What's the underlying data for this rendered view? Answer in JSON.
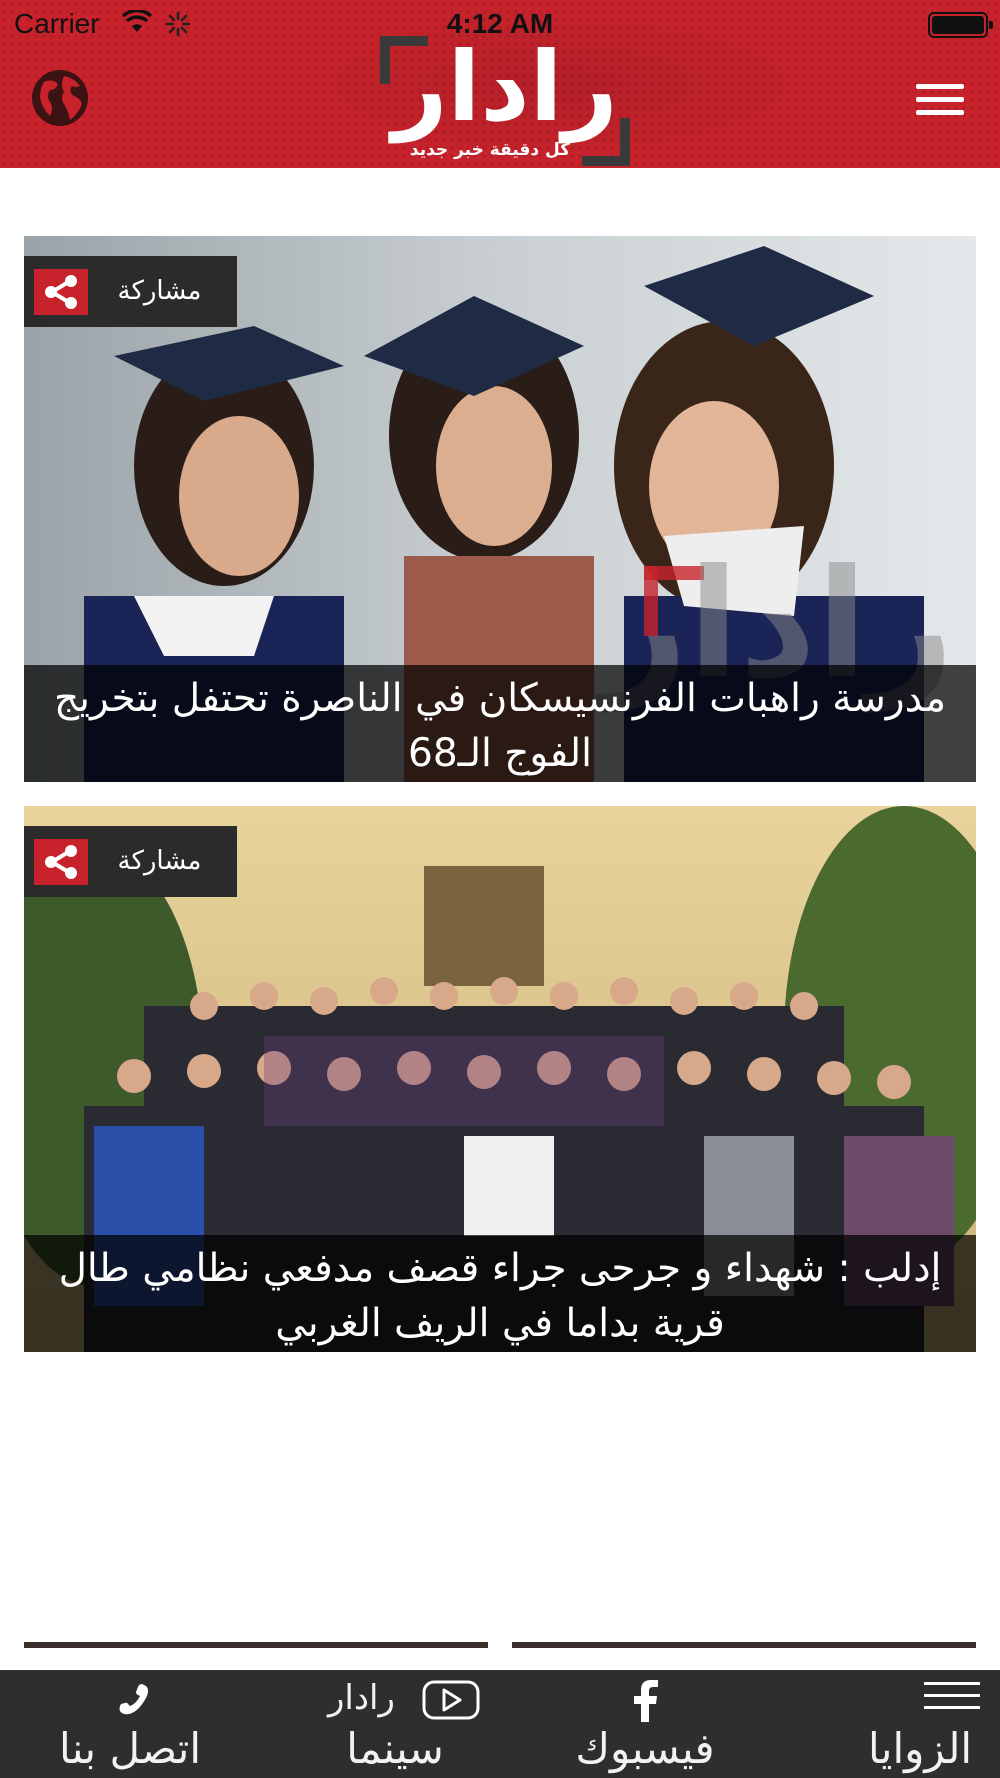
{
  "status_bar": {
    "carrier": "Carrier",
    "time": "4:12 AM"
  },
  "header": {
    "logo_text": "رادار",
    "logo_tagline": "كل دقيقة خبر جديد",
    "left_icon": "globe-icon",
    "right_icon": "menu-icon"
  },
  "articles": [
    {
      "share_label": "مشاركة",
      "title": "مدرسة راهبات الفرنسيسكان في الناصرة تحتفل بتخريج الفوج الـ68"
    },
    {
      "share_label": "مشاركة",
      "title": "إدلب : شهداء و جرحى جراء قصف مدفعي نظامي طال قرية بداما في الريف الغربي"
    }
  ],
  "tabbar": {
    "items": [
      {
        "label": "اتصل بنا",
        "icon": "phone-icon"
      },
      {
        "label": "رادار",
        "sublabel": "سينما",
        "icon": "play-icon"
      },
      {
        "label": "فيسبوك",
        "icon": "facebook-icon"
      },
      {
        "label": "الزوايا",
        "icon": "list-icon"
      }
    ]
  },
  "colors": {
    "brand_red": "#c8232c",
    "dark": "#2e2e2e"
  }
}
